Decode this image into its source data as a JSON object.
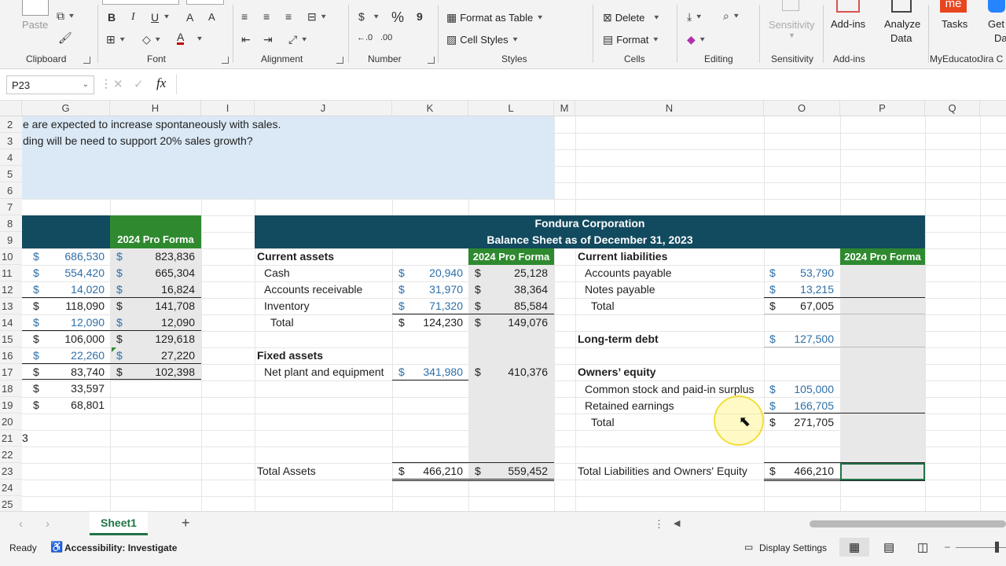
{
  "ribbon": {
    "clipboard": {
      "paste_label": "Paste",
      "group_label": "Clipboard"
    },
    "font": {
      "bold": "B",
      "italic": "I",
      "underline": "U",
      "grow": "A",
      "shrink": "A",
      "color_a": "A",
      "group_label": "Font"
    },
    "alignment": {
      "group_label": "Alignment"
    },
    "number": {
      "currency": "$",
      "percent": "%",
      "comma": "9",
      "group_label": "Number"
    },
    "styles": {
      "format_table": "Format as Table",
      "cell_styles": "Cell Styles",
      "group_label": "Styles"
    },
    "cells": {
      "delete": "Delete",
      "format": "Format",
      "group_label": "Cells"
    },
    "editing": {
      "group_label": "Editing"
    },
    "sensitivity": {
      "label": "Sensitivity",
      "group_label": "Sensitivity"
    },
    "addins": {
      "label": "Add-ins",
      "group_label": "Add-ins"
    },
    "analyze": {
      "label1": "Analyze",
      "label2": "Data"
    },
    "tasks": {
      "label": "Tasks",
      "badge": "me",
      "group_label": "MyEducator"
    },
    "get": {
      "label1": "Get",
      "label2": "Da",
      "group_label": "Jira C"
    }
  },
  "formula_bar": {
    "name_box": "P23",
    "fx": "fx",
    "cancel": "✕",
    "enter": "✓"
  },
  "columns": [
    "G",
    "H",
    "I",
    "J",
    "K",
    "L",
    "M",
    "N",
    "O",
    "P",
    "Q"
  ],
  "rows": [
    "2",
    "3",
    "4",
    "5",
    "6",
    "7",
    "8",
    "9",
    "10",
    "11",
    "12",
    "13",
    "14",
    "15",
    "16",
    "17",
    "18",
    "19",
    "20",
    "21",
    "22",
    "23",
    "24",
    "25"
  ],
  "note": {
    "line1": "e are expected to increase spontaneously with sales.",
    "line2": "ding will be need to support 20% sales growth?"
  },
  "left_table": {
    "header": "2024 Pro Forma",
    "dollar": "$",
    "rows": [
      {
        "g": "686,530",
        "h": "823,836",
        "g_blue": true
      },
      {
        "g": "554,420",
        "h": "665,304",
        "g_blue": true
      },
      {
        "g": "14,020",
        "h": "16,824",
        "g_blue": true
      },
      {
        "g": "118,090",
        "h": "141,708",
        "g_blue": false
      },
      {
        "g": "12,090",
        "h": "12,090",
        "g_blue": true
      },
      {
        "g": "106,000",
        "h": "129,618",
        "g_blue": false
      },
      {
        "g": "22,260",
        "h": "27,220",
        "g_blue": true
      },
      {
        "g": "83,740",
        "h": "102,398",
        "g_blue": false
      },
      {
        "g": "33,597",
        "h": "",
        "g_blue": false
      },
      {
        "g": "68,801",
        "h": "",
        "g_blue": false
      }
    ],
    "row21_frag": "3"
  },
  "balance_sheet": {
    "title": "Fondura Corporation",
    "subtitle": "Balance Sheet as of December 31, 2023",
    "pro_forma": "2024 Pro Forma",
    "current_assets": "Current assets",
    "cash": "Cash",
    "ar": "Accounts receivable",
    "inventory": "Inventory",
    "total": "Total",
    "fixed_assets": "Fixed assets",
    "npe": "Net plant and equipment",
    "total_assets": "Total Assets",
    "current_liabilities": "Current liabilities",
    "ap": "Accounts payable",
    "np": "Notes payable",
    "ltd": "Long-term debt",
    "owners_equity": "Owners’ equity",
    "common_stock": "Common stock and paid-in surplus",
    "retained": "Retained earnings",
    "total_le": "Total Liabilities and Owners' Equity",
    "dollar": "$",
    "values": {
      "cash_k": "20,940",
      "cash_l": "25,128",
      "ar_k": "31,970",
      "ar_l": "38,364",
      "inv_k": "71,320",
      "inv_l": "85,584",
      "ca_total_k": "124,230",
      "ca_total_l": "149,076",
      "npe_k": "341,980",
      "npe_l": "410,376",
      "ta_k": "466,210",
      "ta_l": "559,452",
      "ap_o": "53,790",
      "np_o": "13,215",
      "cl_total_o": "67,005",
      "ltd_o": "127,500",
      "cs_o": "105,000",
      "re_o": "166,705",
      "oe_total_o": "271,705",
      "tle_o": "466,210"
    }
  },
  "sheet_tabs": {
    "active": "Sheet1",
    "add": "+"
  },
  "status": {
    "ready": "Ready",
    "accessibility": "Accessibility: Investigate",
    "display": "Display Settings"
  },
  "colors": {
    "header_band": "#124a5f",
    "pro_forma_green": "#2f8a2f",
    "note_fill": "#dbe9f6",
    "input_blue": "#2e6fa8"
  }
}
